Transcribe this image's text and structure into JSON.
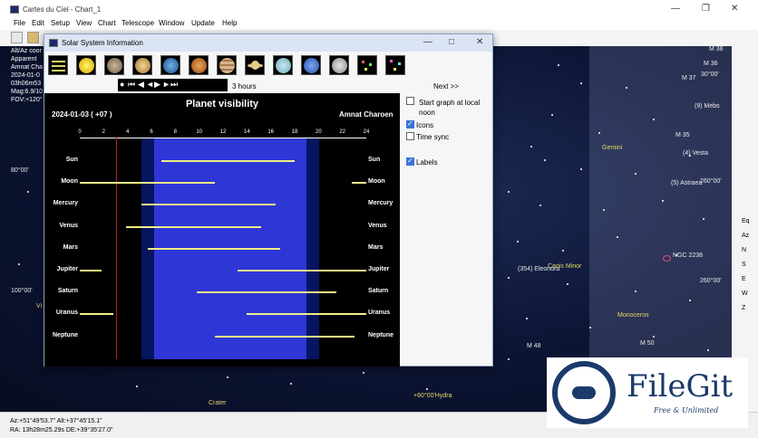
{
  "window": {
    "title": "Cartes du Ciel - Chart_1"
  },
  "menu": [
    "File",
    "Edit",
    "Setup",
    "View",
    "Chart",
    "Telescope",
    "Window",
    "Update",
    "Help"
  ],
  "sky": {
    "info_lines": [
      "Alt/Az coor",
      "Apparent",
      "Amnat Cha",
      "2024-01-0",
      "03h06m53",
      "Mag:6.9/10",
      "FOV:+120°"
    ],
    "labels": {
      "m38": "M 38",
      "m36": "M 36",
      "m37": "M 37",
      "deg30": "30°00'",
      "mebs": "(9) Mebs",
      "m35": "M 35",
      "gemini": "Gemini",
      "vesta": "(4) Vesta",
      "astraea": "(5) Astraea",
      "deg260a": "260°00'",
      "deg80": "80°00'",
      "ngc2238": "NGC 2238",
      "eleonora": "(354) Eleonora",
      "canis_minor": "Canis Minor",
      "deg260b": "260°00'",
      "deg100": "100°00'",
      "monoceros": "Monoceros",
      "m48": "M 48",
      "m50": "M 50",
      "crater": "Crater",
      "hydra": "+60°00'Hydra",
      "vi": "Vi"
    }
  },
  "right_toolbar": [
    "Eq",
    "Az",
    "N",
    "S",
    "E",
    "W",
    "Z"
  ],
  "status": {
    "line1": "Az:+51°49'53.7\" Alt:+37°45'15.1\"",
    "line2": "RA: 13h28m25.29s DE:+39°35'27.0\""
  },
  "dialog": {
    "title": "Solar System Information",
    "step": "3 hours",
    "next": "Next   >>",
    "options": [
      {
        "label": "Start graph at local noon",
        "checked": false
      },
      {
        "label": "Icons",
        "checked": true
      },
      {
        "label": "Time sync",
        "checked": false
      },
      {
        "label": "Labels",
        "checked": true
      }
    ]
  },
  "graph": {
    "title": "Planet visibility",
    "date": "2024-01-03  ( +07 )",
    "observer": "Amnat Charoen",
    "ticks": [
      "0",
      "2",
      "4",
      "6",
      "8",
      "10",
      "12",
      "14",
      "16",
      "18",
      "20",
      "22",
      "24"
    ],
    "now_hour": 3.05,
    "planets": [
      {
        "name": "Sun",
        "segments": [
          [
            6.8,
            18.0
          ]
        ]
      },
      {
        "name": "Moon",
        "segments": [
          [
            0,
            11.3
          ],
          [
            22.8,
            24
          ]
        ]
      },
      {
        "name": "Mercury",
        "segments": [
          [
            5.2,
            16.4
          ]
        ]
      },
      {
        "name": "Venus",
        "segments": [
          [
            3.9,
            15.2
          ]
        ]
      },
      {
        "name": "Mars",
        "segments": [
          [
            5.7,
            16.8
          ]
        ]
      },
      {
        "name": "Jupiter",
        "segments": [
          [
            0,
            1.8
          ],
          [
            13.2,
            24
          ]
        ]
      },
      {
        "name": "Saturn",
        "segments": [
          [
            9.8,
            21.5
          ]
        ]
      },
      {
        "name": "Uranus",
        "segments": [
          [
            0,
            2.8
          ],
          [
            14.0,
            24
          ]
        ]
      },
      {
        "name": "Neptune",
        "segments": [
          [
            11.3,
            23.0
          ]
        ]
      }
    ]
  },
  "watermark": {
    "name": "FileGit",
    "tagline": "Free & Unlimited"
  }
}
